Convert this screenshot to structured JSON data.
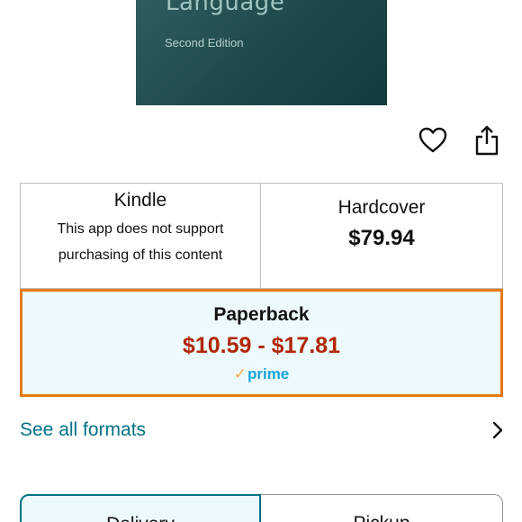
{
  "book": {
    "cover_title": "Language",
    "cover_edition": "Second Edition"
  },
  "actions": {
    "wishlist_icon": "heart-icon",
    "share_icon": "share-icon"
  },
  "formats": {
    "kindle": {
      "name": "Kindle",
      "note_line1": "This app does not support",
      "note_line2": "purchasing of this content"
    },
    "hardcover": {
      "name": "Hardcover",
      "price": "$79.94"
    },
    "paperback": {
      "name": "Paperback",
      "price": "$10.59 - $17.81",
      "badge": "prime",
      "selected": true
    }
  },
  "see_all": {
    "label": "See all formats",
    "icon": "chevron-right-icon"
  },
  "tabs": [
    {
      "label": "Delivery",
      "selected": true
    },
    {
      "label": "Pickup",
      "selected": false
    }
  ],
  "colors": {
    "selected_border": "#e47911",
    "selected_bg": "#edfafd",
    "price_red": "#b12704",
    "link_teal": "#007185",
    "prime_blue": "#1aa3d9",
    "prime_check": "#f3a847"
  }
}
